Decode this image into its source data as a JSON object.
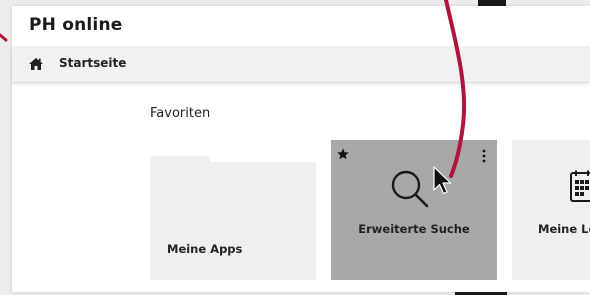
{
  "app": {
    "title": "PH online"
  },
  "breadcrumb": {
    "home_icon": "home-icon",
    "label": "Startseite"
  },
  "favorites": {
    "heading": "Favoriten",
    "tiles": [
      {
        "label": "Meine Apps",
        "icon": "folder-icon",
        "selected": false
      },
      {
        "label": "Erweiterte Suche",
        "icon": "magnifier-icon",
        "selected": true,
        "favorite_icon": "star-icon",
        "menu_icon": "kebab-icon"
      },
      {
        "label": "Meine Le",
        "icon": "calendar-icon",
        "selected": false
      }
    ]
  },
  "colors": {
    "selected_tile": "#a8a8a8",
    "tile_background": "#efefef",
    "annotation_arrow": "#b0153c"
  }
}
